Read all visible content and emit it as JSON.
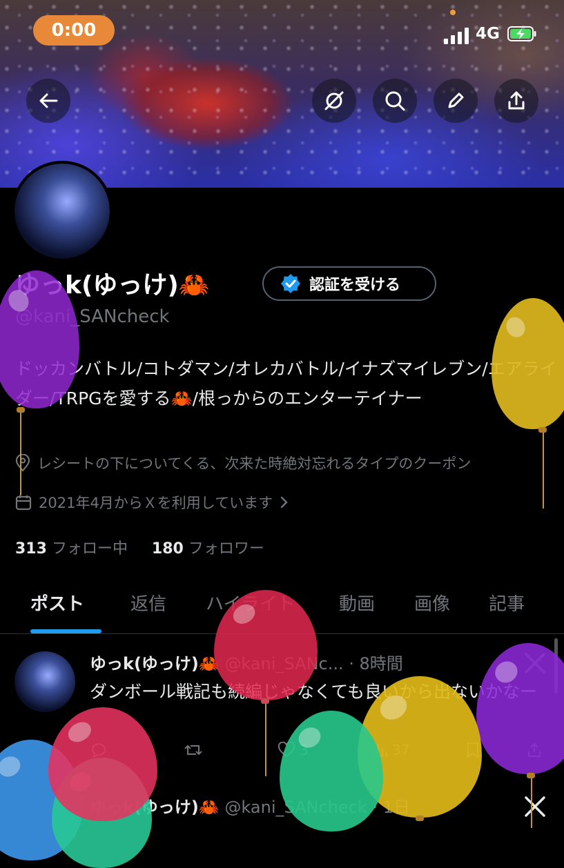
{
  "status_bar": {
    "time": "0:00",
    "network": "4G"
  },
  "profile": {
    "display_name": "ゆっk(ゆっけ)🦀",
    "verify_label": "認証を受ける",
    "handle": "@kani_SANcheck",
    "bio": "ドッカンバトル/コトダマン/オレカバトル/イナズマイレブン/エアライダー/TRPGを愛する🦀/根っからのエンターテイナー",
    "location": "レシートの下についてくる、次来た時絶対忘れるタイプのクーポン",
    "joined": "2021年4月からＸを利用しています",
    "following_count": "313",
    "following_label": "フォロー中",
    "followers_count": "180",
    "followers_label": "フォロワー"
  },
  "tabs": [
    {
      "label": "ポスト"
    },
    {
      "label": "返信"
    },
    {
      "label": "ハイライト"
    },
    {
      "label": "動画"
    },
    {
      "label": "画像"
    },
    {
      "label": "記事"
    }
  ],
  "posts": [
    {
      "name": "ゆっk(ゆっけ)🦀",
      "handle": "@kani_SANc...",
      "time": "· 8時間",
      "text": "ダンボール戦記も続編じゃなくても良いから出ないかなー",
      "likes": "3",
      "views": "37"
    },
    {
      "name": "ゆっk(ゆっけ)🦀",
      "handle": "@kani_SANcheck",
      "time": "· 1日"
    }
  ],
  "colors": {
    "accent": "#1d9bf0",
    "status_pill": "#e8893a",
    "verified": "#1d9bf0"
  }
}
